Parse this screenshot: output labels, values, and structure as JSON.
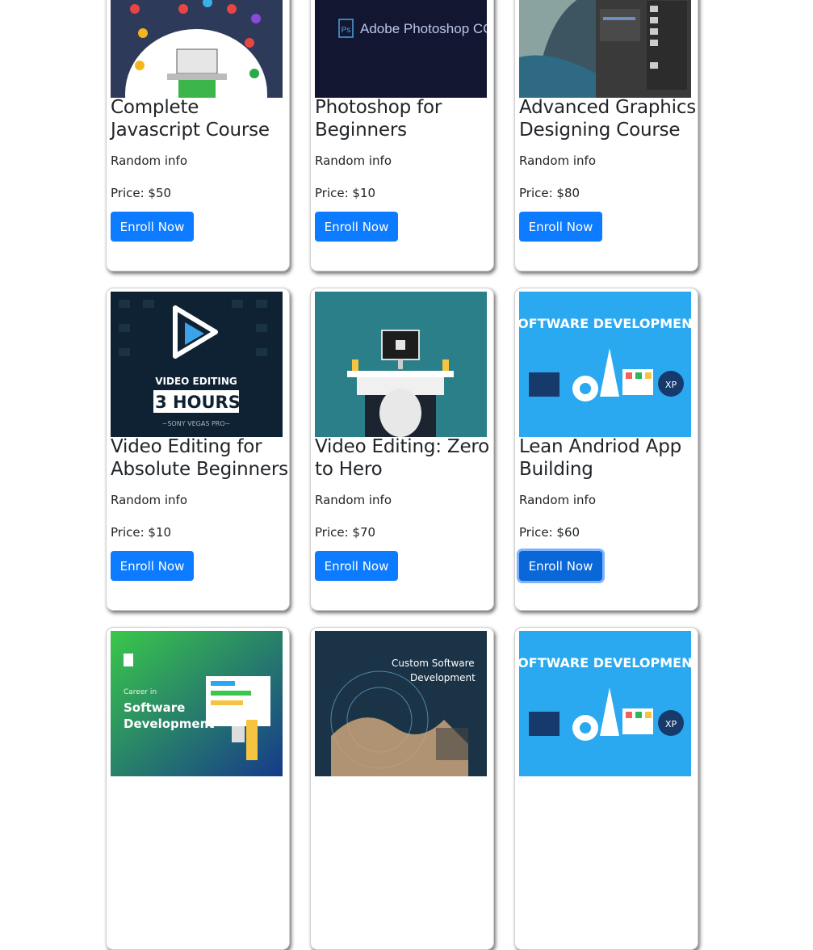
{
  "courses": [
    {
      "title": "Complete Javascript Course",
      "info": "Random info",
      "price": "Price: $50",
      "button": "Enroll Now",
      "image_icon": "javascript-course-icon"
    },
    {
      "title": "Photoshop for Beginners",
      "info": "Random info",
      "price": "Price: $10",
      "button": "Enroll Now",
      "image_icon": "photoshop-icon",
      "image_text": "Adobe Photoshop CC",
      "image_badge": "Ps"
    },
    {
      "title": "Advanced Graphics Designing Course",
      "info": "Random info",
      "price": "Price: $80",
      "button": "Enroll Now",
      "image_icon": "graphics-design-icon"
    },
    {
      "title": "Video Editing for Absolute Beginners",
      "info": "Random info",
      "price": "Price: $10",
      "button": "Enroll Now",
      "image_icon": "video-editing-icon",
      "image_text": "VIDEO EDITING",
      "image_text2": "IN 3 HOURS!!!",
      "image_text3": "~SONY VEGAS PRO~"
    },
    {
      "title": "Video Editing: Zero to Hero",
      "info": "Random info",
      "price": "Price: $70",
      "button": "Enroll Now",
      "image_icon": "video-workstation-icon"
    },
    {
      "title": "Lean Andriod App Building",
      "info": "Random info",
      "price": "Price: $60",
      "button": "Enroll Now",
      "image_icon": "software-development-icon",
      "image_text": "SOFTWARE DEVELOPMENT",
      "focused": true
    },
    {
      "title": "",
      "info": "",
      "price": "",
      "button": "",
      "image_icon": "software-career-icon",
      "image_text": "Career in",
      "image_text2": "Software",
      "image_text3": "Development"
    },
    {
      "title": "",
      "info": "",
      "price": "",
      "button": "",
      "image_icon": "custom-software-icon",
      "image_text": "Custom Software",
      "image_text2": "Development"
    },
    {
      "title": "",
      "info": "",
      "price": "",
      "button": "",
      "image_icon": "software-development-icon",
      "image_text": "SOFTWARE DEVELOPMENT"
    }
  ],
  "colors": {
    "button": "#0d7bff",
    "card_border": "#cfcfcf",
    "text": "#212529"
  }
}
